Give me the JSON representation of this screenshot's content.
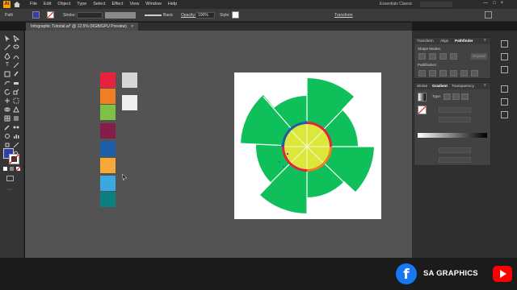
{
  "app": {
    "logo": "Ai",
    "menu": [
      "File",
      "Edit",
      "Object",
      "Type",
      "Select",
      "Effect",
      "View",
      "Window",
      "Help"
    ],
    "workspace": "Essentials Classic",
    "window_buttons": [
      "—",
      "□",
      "×"
    ]
  },
  "controlbar": {
    "selection_label": "Path",
    "stroke_label": "Stroke:",
    "brush_label": "Basic",
    "opacity_label": "Opacity:",
    "opacity_value": "100%",
    "style_label": "Style:",
    "transform_label": "Transform"
  },
  "document": {
    "tab_title": "Infographic Tutorial.ai* @ 12.5% (RGB/GPU Preview)",
    "tab_close": "×"
  },
  "panels": {
    "top_tabs": [
      "Transform",
      "Align",
      "Pathfinder"
    ],
    "shape_modes_label": "Shape Modes:",
    "expand_label": "Expand",
    "pathfinders_label": "Pathfinders:",
    "gradient_tabs": [
      "Stroke",
      "Gradient",
      "Transparency"
    ],
    "type_label": "Type:",
    "menu_glyph": "≡"
  },
  "swatches": {
    "column": [
      "#e8213f",
      "#ef7f22",
      "#7dc242",
      "#861c4a",
      "#1c5ea9",
      "#f4a93a",
      "#3aa9df",
      "#0e7f80"
    ],
    "side": [
      "#d6d6d6",
      "#efefef"
    ]
  },
  "colors": {
    "fill_swatch": "#2f3ea8",
    "green_shape": "#0fbf5a",
    "inner_circle": "#dbe83a"
  },
  "footer": {
    "brand": "SA GRAPHICS",
    "facebook_icon": "f"
  }
}
